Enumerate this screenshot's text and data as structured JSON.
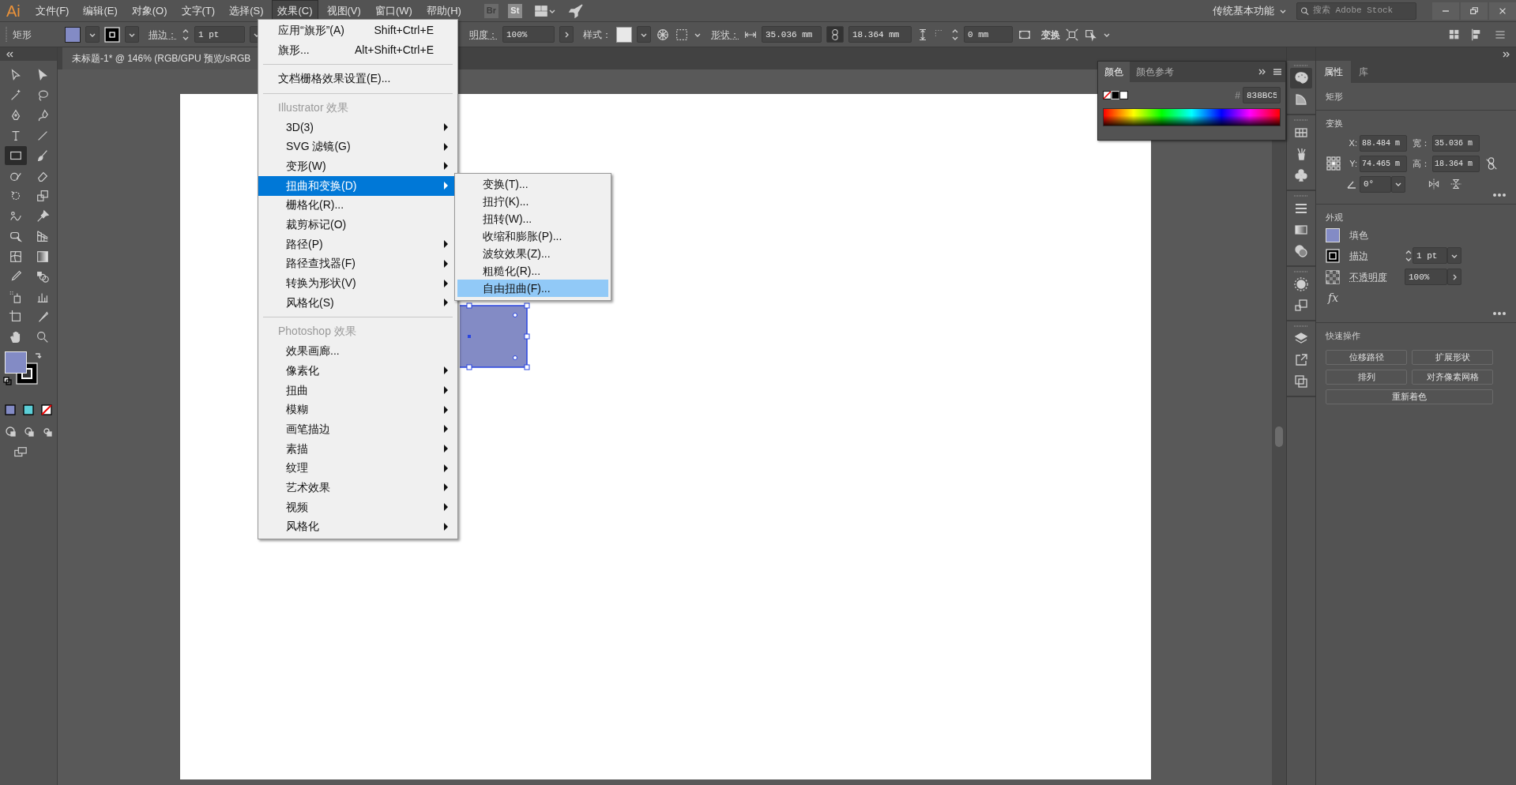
{
  "menu_bar": {
    "logo": "Ai",
    "items": [
      {
        "label": "文件(F)",
        "selected": false
      },
      {
        "label": "编辑(E)",
        "selected": false
      },
      {
        "label": "对象(O)",
        "selected": false
      },
      {
        "label": "文字(T)",
        "selected": false
      },
      {
        "label": "选择(S)",
        "selected": false
      },
      {
        "label": "效果(C)",
        "selected": true
      },
      {
        "label": "视图(V)",
        "selected": false
      },
      {
        "label": "窗口(W)",
        "selected": false
      },
      {
        "label": "帮助(H)",
        "selected": false
      }
    ],
    "bridge": "Br",
    "stock": "St",
    "workspace": "传统基本功能",
    "search": {
      "placeholder": "搜索 Adobe Stock"
    }
  },
  "control_bar": {
    "object_type": "矩形",
    "stroke_label": "描边：",
    "stroke_weight": "1 pt",
    "opacity_label": "明度：",
    "opacity": "100%",
    "style_label": "样式：",
    "shape_label": "形状：",
    "width": "35.036 mm",
    "height": "18.364 mm",
    "corner_radius": "0 mm",
    "transform": "变换"
  },
  "document_tab": {
    "title": "未标题-1* @ 146% (RGB/GPU 预览/sRGB"
  },
  "tools": [
    {
      "kind": "direct-select",
      "selected": false
    },
    {
      "kind": "select",
      "selected": false
    },
    {
      "kind": "wand",
      "selected": false
    },
    {
      "kind": "lasso",
      "selected": false
    },
    {
      "kind": "pen",
      "selected": false
    },
    {
      "kind": "curvature",
      "selected": false
    },
    {
      "kind": "type",
      "selected": false
    },
    {
      "kind": "line",
      "selected": false
    },
    {
      "kind": "rectangle",
      "selected": true
    },
    {
      "kind": "brush",
      "selected": false
    },
    {
      "kind": "shaper",
      "selected": false
    },
    {
      "kind": "eraser",
      "selected": false
    },
    {
      "kind": "rotate",
      "selected": false
    },
    {
      "kind": "scale",
      "selected": false
    },
    {
      "kind": "warp",
      "selected": false
    },
    {
      "kind": "pin",
      "selected": false
    },
    {
      "kind": "free-transform",
      "selected": false
    },
    {
      "kind": "perspective",
      "selected": false
    },
    {
      "kind": "mesh",
      "selected": false
    },
    {
      "kind": "gradient",
      "selected": false
    },
    {
      "kind": "eyedropper",
      "selected": false
    },
    {
      "kind": "blend",
      "selected": false
    },
    {
      "kind": "sprayer",
      "selected": false
    },
    {
      "kind": "graph",
      "selected": false
    },
    {
      "kind": "artboard",
      "selected": false
    },
    {
      "kind": "slice",
      "selected": false
    },
    {
      "kind": "hand",
      "selected": false
    },
    {
      "kind": "zoom",
      "selected": false
    }
  ],
  "effect_menu": {
    "items": [
      {
        "kind": "command",
        "label": "应用“旗形”(A)",
        "shortcut": "Shift+Ctrl+E",
        "has_submenu": false,
        "selected": false
      },
      {
        "kind": "command",
        "label": "旗形...",
        "shortcut": "Alt+Shift+Ctrl+E",
        "has_submenu": false,
        "selected": false
      },
      {
        "kind": "separator"
      },
      {
        "kind": "command",
        "label": "文档栅格效果设置(E)...",
        "has_submenu": false,
        "selected": false
      },
      {
        "kind": "separator"
      },
      {
        "kind": "header",
        "label": "Illustrator 效果"
      },
      {
        "kind": "item",
        "label": "3D(3)",
        "has_submenu": true,
        "selected": false
      },
      {
        "kind": "item",
        "label": "SVG 滤镜(G)",
        "has_submenu": true,
        "selected": false
      },
      {
        "kind": "item",
        "label": "变形(W)",
        "has_submenu": true,
        "selected": false
      },
      {
        "kind": "item",
        "label": "扭曲和变换(D)",
        "has_submenu": true,
        "selected": true
      },
      {
        "kind": "item",
        "label": "栅格化(R)...",
        "has_submenu": false,
        "selected": false
      },
      {
        "kind": "item",
        "label": "裁剪标记(O)",
        "has_submenu": false,
        "selected": false
      },
      {
        "kind": "item",
        "label": "路径(P)",
        "has_submenu": true,
        "selected": false
      },
      {
        "kind": "item",
        "label": "路径查找器(F)",
        "has_submenu": true,
        "selected": false
      },
      {
        "kind": "item",
        "label": "转换为形状(V)",
        "has_submenu": true,
        "selected": false
      },
      {
        "kind": "item",
        "label": "风格化(S)",
        "has_submenu": true,
        "selected": false
      },
      {
        "kind": "separator"
      },
      {
        "kind": "header",
        "label": "Photoshop 效果"
      },
      {
        "kind": "item",
        "label": "效果画廊...",
        "has_submenu": false,
        "selected": false
      },
      {
        "kind": "item",
        "label": "像素化",
        "has_submenu": true,
        "selected": false
      },
      {
        "kind": "item",
        "label": "扭曲",
        "has_submenu": true,
        "selected": false
      },
      {
        "kind": "item",
        "label": "模糊",
        "has_submenu": true,
        "selected": false
      },
      {
        "kind": "item",
        "label": "画笔描边",
        "has_submenu": true,
        "selected": false
      },
      {
        "kind": "item",
        "label": "素描",
        "has_submenu": true,
        "selected": false
      },
      {
        "kind": "item",
        "label": "纹理",
        "has_submenu": true,
        "selected": false
      },
      {
        "kind": "item",
        "label": "艺术效果",
        "has_submenu": true,
        "selected": false
      },
      {
        "kind": "item",
        "label": "视频",
        "has_submenu": true,
        "selected": false
      },
      {
        "kind": "item",
        "label": "风格化",
        "has_submenu": true,
        "selected": false
      }
    ]
  },
  "submenu": {
    "items": [
      {
        "label": "变换(T)...",
        "selected": false
      },
      {
        "label": "扭拧(K)...",
        "selected": false
      },
      {
        "label": "扭转(W)...",
        "selected": false
      },
      {
        "label": "收缩和膨胀(P)...",
        "selected": false
      },
      {
        "label": "波纹效果(Z)...",
        "selected": false
      },
      {
        "label": "粗糙化(R)...",
        "selected": false
      },
      {
        "label": "自由扭曲(F)...",
        "selected": true
      }
    ]
  },
  "color_panel": {
    "tabs": [
      {
        "label": "颜色",
        "selected": true
      },
      {
        "label": "颜色参考",
        "selected": false
      }
    ],
    "hex_label": "#",
    "hex": "838BC5"
  },
  "properties_panel": {
    "tabs": [
      {
        "label": "属性",
        "selected": true
      },
      {
        "label": "库",
        "selected": false
      }
    ],
    "object_type": "矩形",
    "transform": {
      "title": "变换",
      "x_label": "X:",
      "x": "88.484 m",
      "width_label": "宽：",
      "width": "35.036 m",
      "y_label": "Y:",
      "y": "74.465 m",
      "height_label": "高：",
      "height": "18.364 m",
      "angle": "0°"
    },
    "appearance": {
      "title": "外观",
      "fill_label": "填色",
      "stroke_label": "描边",
      "stroke_weight": "1 pt",
      "opacity_label": "不透明度",
      "opacity": "100%",
      "fx": "fx"
    },
    "quick_actions": {
      "title": "快速操作",
      "buttons": [
        "位移路径",
        "扩展形状",
        "排列",
        "对齐像素网格",
        "重新着色"
      ]
    }
  }
}
